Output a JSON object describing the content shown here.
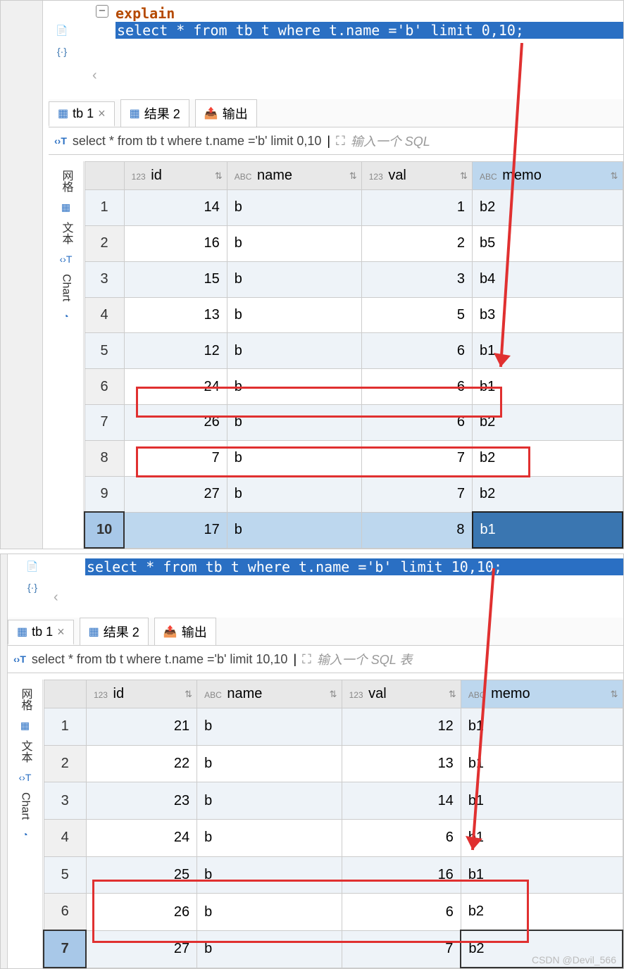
{
  "pane1": {
    "explain": "explain",
    "sql_full": "select * from tb t where t.name ='b' limit 0,10;",
    "back_chevron": "‹",
    "tabs": [
      {
        "label": "tb 1",
        "active": true,
        "close": "×"
      },
      {
        "label": "结果 2"
      },
      {
        "label": "输出"
      }
    ],
    "sqlbar_text": "select * from tb t where t.name ='b' limit 0,10",
    "sql_placeholder": "输入一个 SQL",
    "side_tabs": {
      "grid": "网格",
      "text": "文本",
      "chart": "Chart"
    },
    "columns": [
      {
        "type": "123",
        "label": "id"
      },
      {
        "type": "ABC",
        "label": "name"
      },
      {
        "type": "123",
        "label": "val"
      },
      {
        "type": "ABC",
        "label": "memo"
      }
    ],
    "rows": [
      {
        "n": "1",
        "id": "14",
        "name": "b",
        "val": "1",
        "memo": "b2"
      },
      {
        "n": "2",
        "id": "16",
        "name": "b",
        "val": "2",
        "memo": "b5"
      },
      {
        "n": "3",
        "id": "15",
        "name": "b",
        "val": "3",
        "memo": "b4"
      },
      {
        "n": "4",
        "id": "13",
        "name": "b",
        "val": "5",
        "memo": "b3"
      },
      {
        "n": "5",
        "id": "12",
        "name": "b",
        "val": "6",
        "memo": "b1"
      },
      {
        "n": "6",
        "id": "24",
        "name": "b",
        "val": "6",
        "memo": "b1"
      },
      {
        "n": "7",
        "id": "26",
        "name": "b",
        "val": "6",
        "memo": "b2"
      },
      {
        "n": "8",
        "id": "7",
        "name": "b",
        "val": "7",
        "memo": "b2"
      },
      {
        "n": "9",
        "id": "27",
        "name": "b",
        "val": "7",
        "memo": "b2"
      },
      {
        "n": "10",
        "id": "17",
        "name": "b",
        "val": "8",
        "memo": "b1"
      }
    ]
  },
  "pane2": {
    "sql_full": "select * from tb t where t.name ='b' limit 10,10;",
    "back_chevron": "‹",
    "tabs": [
      {
        "label": "tb 1",
        "active": true,
        "close": "×"
      },
      {
        "label": "结果 2"
      },
      {
        "label": "输出"
      }
    ],
    "sqlbar_text": "select * from tb t where t.name ='b' limit 10,10",
    "sql_placeholder": "输入一个 SQL 表",
    "side_tabs": {
      "grid": "网格",
      "text": "文本",
      "chart": "Chart"
    },
    "columns": [
      {
        "type": "123",
        "label": "id"
      },
      {
        "type": "ABC",
        "label": "name"
      },
      {
        "type": "123",
        "label": "val"
      },
      {
        "type": "ABC",
        "label": "memo"
      }
    ],
    "rows": [
      {
        "n": "1",
        "id": "21",
        "name": "b",
        "val": "12",
        "memo": "b1"
      },
      {
        "n": "2",
        "id": "22",
        "name": "b",
        "val": "13",
        "memo": "b1"
      },
      {
        "n": "3",
        "id": "23",
        "name": "b",
        "val": "14",
        "memo": "b1"
      },
      {
        "n": "4",
        "id": "24",
        "name": "b",
        "val": "6",
        "memo": "b1"
      },
      {
        "n": "5",
        "id": "25",
        "name": "b",
        "val": "16",
        "memo": "b1"
      },
      {
        "n": "6",
        "id": "26",
        "name": "b",
        "val": "6",
        "memo": "b2"
      },
      {
        "n": "7",
        "id": "27",
        "name": "b",
        "val": "7",
        "memo": "b2"
      }
    ]
  },
  "watermark": "CSDN @Devil_566"
}
